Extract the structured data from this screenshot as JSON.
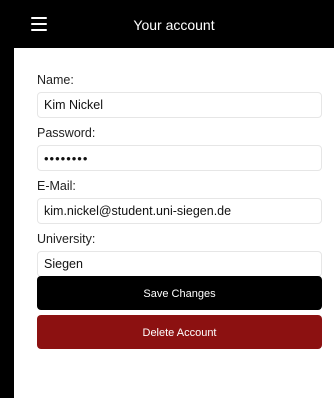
{
  "header": {
    "title": "Your account",
    "menu_icon": "hamburger-menu-icon"
  },
  "form": {
    "name_label": "Name:",
    "name_value": "Kim Nickel",
    "password_label": "Password:",
    "password_value": "••••••••",
    "email_label": "E-Mail:",
    "email_value": "kim.nickel@student.uni-siegen.de",
    "university_label": "University:",
    "university_value": "Siegen"
  },
  "actions": {
    "save_label": "Save Changes",
    "delete_label": "Delete Account"
  },
  "colors": {
    "navbar": "#000000",
    "save_button": "#000000",
    "delete_button": "#8c1111"
  }
}
